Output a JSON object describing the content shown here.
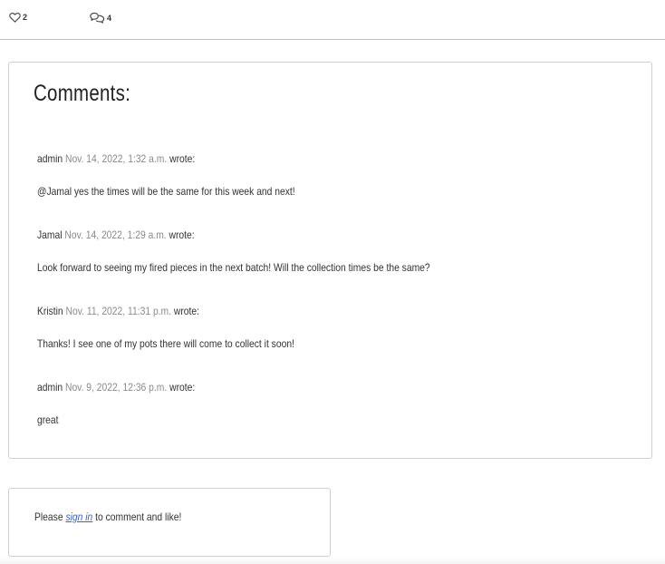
{
  "stats": {
    "likes_count": "2",
    "comments_count": "4",
    "like_icon": "heart-icon",
    "comment_icon": "speech-bubbles-icon"
  },
  "comments_section": {
    "title": "Comments:",
    "wrote_label": "wrote:",
    "items": [
      {
        "author": "admin",
        "date": "Nov. 14, 2022, 1:32 a.m.",
        "text": "@Jamal yes the times will be the same for this week and next!"
      },
      {
        "author": "Jamal",
        "date": "Nov. 14, 2022, 1:29 a.m.",
        "text": "Look forward to seeing my fired pieces in the next batch! Will the collection times be the same?"
      },
      {
        "author": "Kristin",
        "date": "Nov. 11, 2022, 11:31 p.m.",
        "text": "Thanks! I see one of my pots there will come to collect it soon!"
      },
      {
        "author": "admin",
        "date": "Nov. 9, 2022, 12:36 p.m.",
        "text": "great"
      }
    ]
  },
  "signin": {
    "prefix": "Please",
    "link_text": "sign in",
    "suffix": "to comment and like!"
  },
  "colors": {
    "link": "#3a63c7",
    "date": "#8a8a8a",
    "border": "#cfcfcf"
  }
}
